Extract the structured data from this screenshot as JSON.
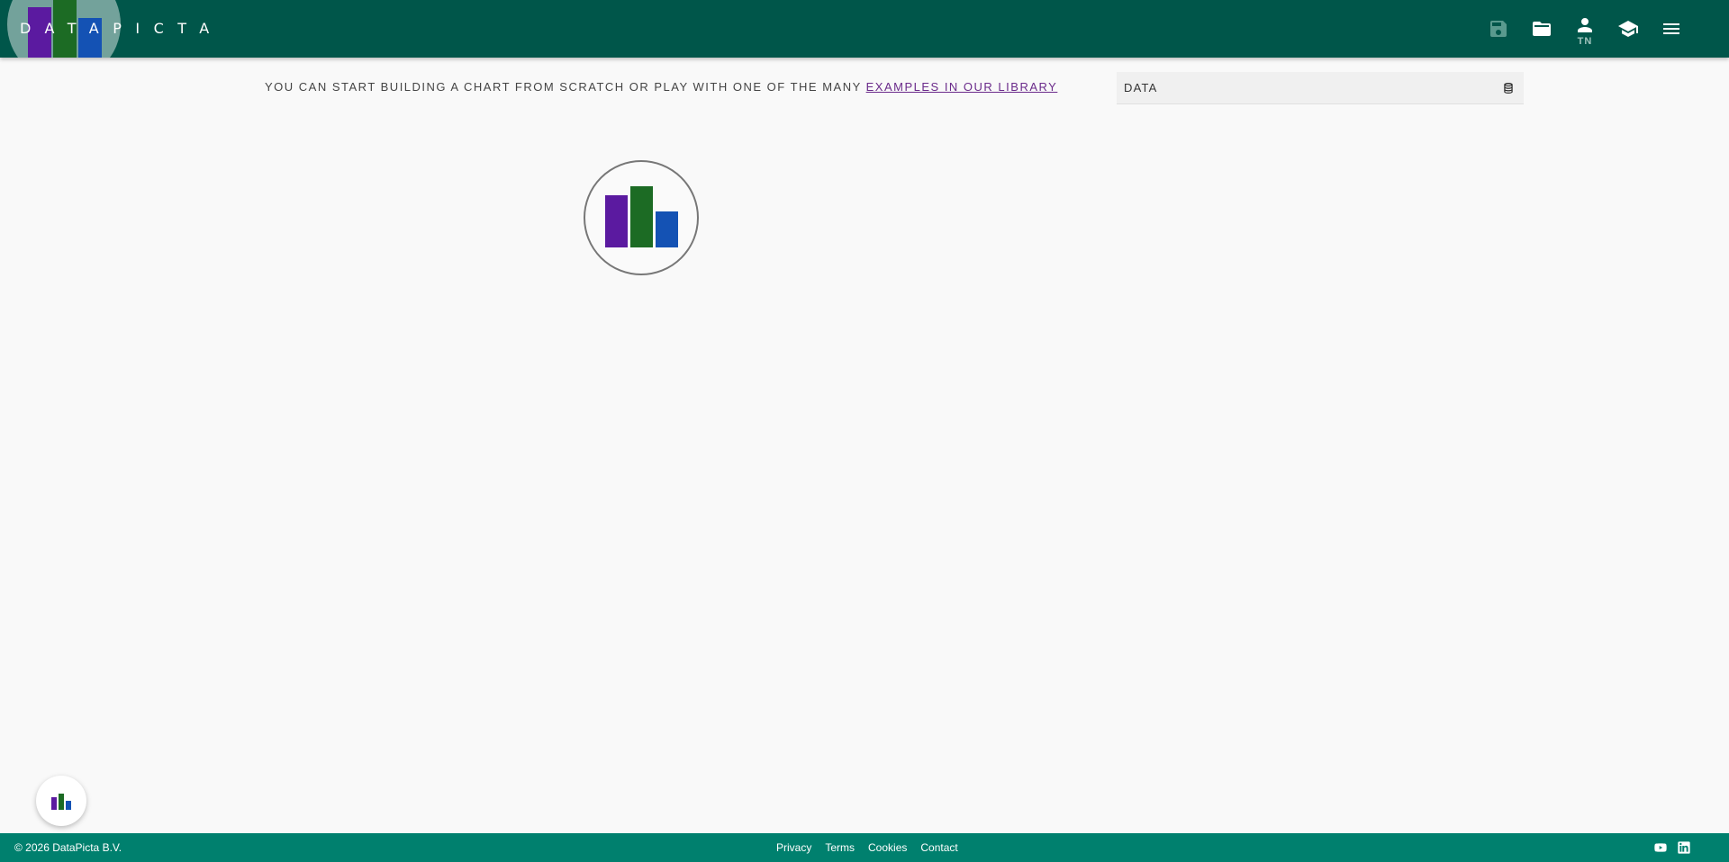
{
  "header": {
    "brand": "DATAPICTA",
    "user_initials": "TN",
    "icons": [
      "save-icon",
      "folder-open-icon",
      "user-icon",
      "graduation-cap-icon",
      "menu-icon"
    ]
  },
  "intro": {
    "text": "YOU CAN START BUILDING A CHART FROM SCRATCH OR PLAY WITH ONE OF THE MANY ",
    "link": "EXAMPLES IN OUR LIBRARY"
  },
  "data_panel": {
    "label": "DATA",
    "icon": "database-icon"
  },
  "footer": {
    "copyright": "© 2026 DataPicta B.V.",
    "links": [
      "Privacy",
      "Terms",
      "Cookies",
      "Contact"
    ],
    "social": [
      "youtube-icon",
      "linkedin-icon"
    ]
  },
  "colors": {
    "header_bg": "#00564a",
    "footer_bg": "#00806e",
    "brand_purple": "#5b1aa0",
    "brand_green": "#1c6b24",
    "brand_blue": "#1452b4",
    "link": "#6a2a8a"
  }
}
